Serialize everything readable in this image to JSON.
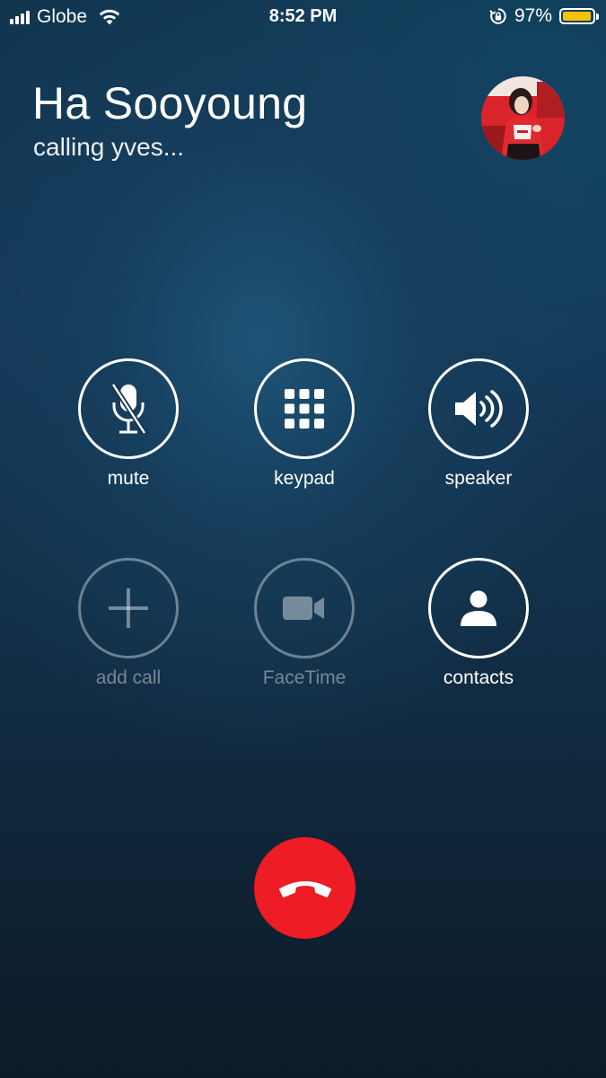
{
  "status_bar": {
    "carrier": "Globe",
    "time": "8:52 PM",
    "battery_percent": "97%",
    "battery_level": 0.97,
    "signal_bars": 4,
    "signal_total": 4,
    "icons": [
      "signal-icon",
      "wifi-icon",
      "rotation-lock-icon",
      "battery-icon"
    ]
  },
  "caller": {
    "name": "Ha Sooyoung",
    "status": "calling yves...",
    "avatar": "contact-photo"
  },
  "controls": [
    {
      "label": "mute",
      "icon": "mute-icon",
      "enabled": true
    },
    {
      "label": "keypad",
      "icon": "keypad-icon",
      "enabled": true
    },
    {
      "label": "speaker",
      "icon": "speaker-icon",
      "enabled": true
    },
    {
      "label": "add call",
      "icon": "plus-icon",
      "enabled": false
    },
    {
      "label": "FaceTime",
      "icon": "video-camera-icon",
      "enabled": false
    },
    {
      "label": "contacts",
      "icon": "person-icon",
      "enabled": true
    }
  ],
  "end_call": {
    "icon": "phone-hangup-icon",
    "color": "#ee1c24"
  },
  "colors": {
    "battery_fill": "#f7c300",
    "end_call": "#ee1c24"
  }
}
